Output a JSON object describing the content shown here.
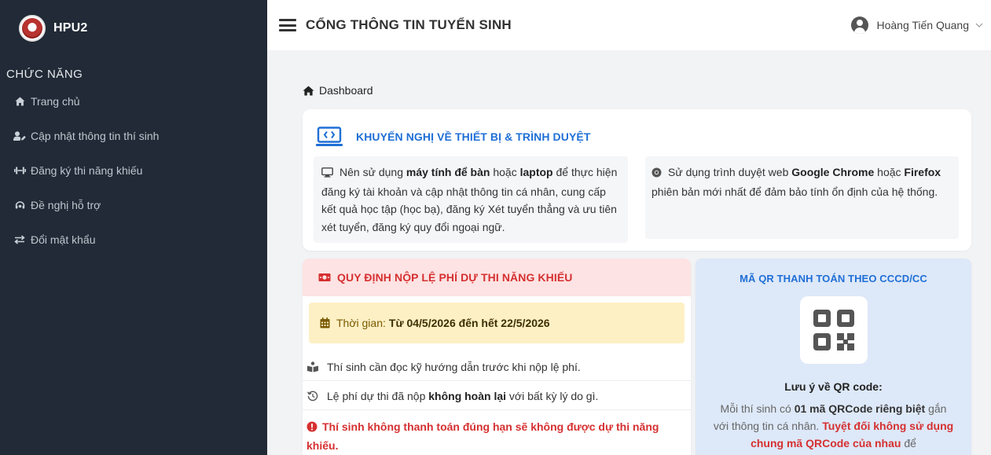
{
  "sidebar": {
    "brand": "HPU2",
    "heading": "CHỨC NĂNG",
    "items": [
      {
        "label": "Trang chủ",
        "icon": "home-icon"
      },
      {
        "label": "Cập nhật thông tin thí sinh",
        "icon": "user-edit-icon"
      },
      {
        "label": "Đăng ký thi năng khiếu",
        "icon": "dumbbell-icon"
      },
      {
        "label": "Đề nghị hỗ trợ",
        "icon": "headset-icon"
      },
      {
        "label": "Đổi mật khẩu",
        "icon": "exchange-icon"
      }
    ]
  },
  "header": {
    "title": "CỔNG THÔNG TIN TUYỂN SINH",
    "user_name": "Hoàng Tiến Quang"
  },
  "breadcrumb": "Dashboard",
  "recommend": {
    "title": "KHUYẾN NGHỊ VỀ THIẾT BỊ & TRÌNH DUYỆT",
    "left": {
      "p1": "Nên sử dụng ",
      "b1": "máy tính để bàn",
      "p2": " hoặc ",
      "b2": "laptop",
      "p3": " để thực hiện đăng ký tài khoản và cập nhật thông tin cá nhân, cung cấp kết quả học tập (học bạ), đăng ký Xét tuyển thẳng và ưu tiên xét tuyển, đăng ký quy đổi ngoại ngữ."
    },
    "right": {
      "p1": "Sử dụng trình duyệt web ",
      "b1": "Google Chrome",
      "p2": " hoặc ",
      "b2": "Firefox",
      "p3": " phiên bản mới nhất để đảm bảo tính ổn định của hệ thống."
    }
  },
  "fee": {
    "title": "QUY ĐỊNH NỘP LỆ PHÍ DỰ THI NĂNG KHIẾU",
    "time_label": "Thời gian:",
    "time_value": "Từ 04/5/2026 đến hết 22/5/2026",
    "row1": "Thí sinh cần đọc kỹ hướng dẫn trước khi nộp lệ phí.",
    "row2_a": "Lệ phí dự thi đã nộp ",
    "row2_b": "không hoàn lại",
    "row2_c": " với bất kỳ lý do gì.",
    "warning": "Thí sinh không thanh toán đúng hạn sẽ không được dự thi năng khiếu."
  },
  "qr": {
    "title": "MÃ QR THANH TOÁN THEO CCCD/CC",
    "note_title": "Lưu ý về QR code:",
    "note_a": "Mỗi thí sinh có ",
    "note_b": "01 mã QRCode riêng biệt",
    "note_c": " gắn với thông tin cá nhân. ",
    "note_d": "Tuyệt đối không sử dụng chung mã QRCode của nhau",
    "note_e": " để"
  },
  "colors": {
    "sidebar_bg": "#212a36",
    "accent_blue": "#1f6fd6",
    "accent_red": "#d63031",
    "fee_header_bg": "#fde3e3",
    "time_bg": "#fdf0c5",
    "qr_bg": "#dde8f8"
  }
}
